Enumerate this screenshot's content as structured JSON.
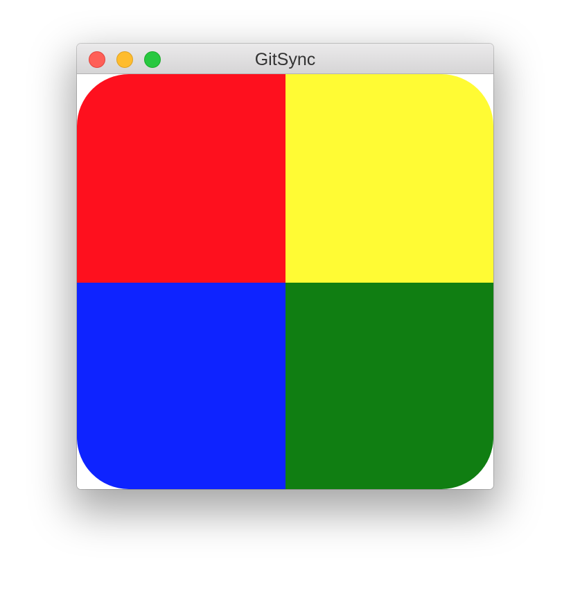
{
  "window": {
    "title": "GitSync"
  },
  "traffic_lights": {
    "close": {
      "color": "#fe5f57",
      "border": "#e0443e"
    },
    "minimize": {
      "color": "#febc2e",
      "border": "#dea123"
    },
    "zoom": {
      "color": "#28c840",
      "border": "#1aab29"
    }
  },
  "quadrants": {
    "top_left": {
      "color": "#fe101e"
    },
    "top_right": {
      "color": "#fffb34"
    },
    "bottom_left": {
      "color": "#0e23ff"
    },
    "bottom_right": {
      "color": "#107e12"
    }
  }
}
